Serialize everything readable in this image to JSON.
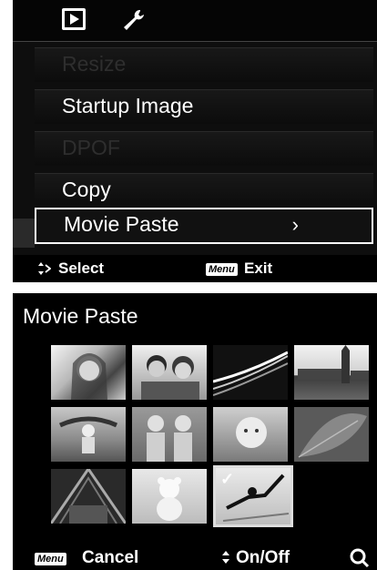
{
  "top_screen": {
    "tabs": [
      {
        "icon": "play-icon"
      },
      {
        "icon": "wrench-icon"
      }
    ],
    "menu_items": [
      {
        "label": "Resize",
        "state": "disabled"
      },
      {
        "label": "Startup Image",
        "state": "enabled"
      },
      {
        "label": "DPOF",
        "state": "disabled"
      },
      {
        "label": "Copy",
        "state": "enabled"
      },
      {
        "label": "Movie Paste",
        "state": "selected",
        "chevron": "›"
      }
    ],
    "footer": {
      "select_label": "Select",
      "menu_key": "Menu",
      "exit_label": "Exit"
    }
  },
  "bottom_screen": {
    "title": "Movie Paste",
    "thumbnails": [
      {
        "subject": "woman-portrait",
        "selected": false
      },
      {
        "subject": "couple-portrait",
        "selected": false
      },
      {
        "subject": "night-road",
        "selected": false
      },
      {
        "subject": "big-ben",
        "selected": false
      },
      {
        "subject": "kids-outdoors",
        "selected": false
      },
      {
        "subject": "two-children",
        "selected": false
      },
      {
        "subject": "baby-portrait",
        "selected": false
      },
      {
        "subject": "leaf-closeup",
        "selected": false
      },
      {
        "subject": "tent-structure",
        "selected": false
      },
      {
        "subject": "teddy-bear",
        "selected": false
      },
      {
        "subject": "skier",
        "selected": true,
        "check": "✓"
      }
    ],
    "footer": {
      "menu_key": "Menu",
      "cancel_label": "Cancel",
      "toggle_label": "On/Off"
    }
  },
  "colors": {
    "screen_bg": "#0e0e0e",
    "text": "#ffffff",
    "disabled_text": "#2e2e2e"
  }
}
